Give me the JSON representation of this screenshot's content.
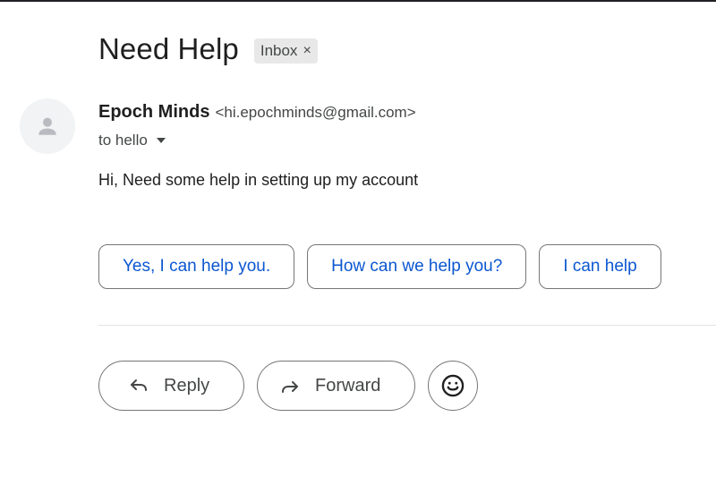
{
  "email": {
    "subject": "Need Help",
    "label": {
      "text": "Inbox",
      "remove_glyph": "×"
    },
    "sender": {
      "name": "Epoch Minds",
      "email": "<hi.epochminds@gmail.com>",
      "avatar_icon": "person-icon"
    },
    "recipient": "to hello",
    "body": "Hi, Need some help in setting up my account"
  },
  "smart_replies": [
    "Yes, I can help you.",
    "How can we help you?",
    "I can help"
  ],
  "actions": {
    "reply_label": "Reply",
    "reply_icon": "reply-arrow-icon",
    "forward_label": "Forward",
    "forward_icon": "forward-arrow-icon",
    "emoji_icon": "smiley-icon"
  },
  "colors": {
    "link_blue": "#0b57d0",
    "text_primary": "#1f1f1f",
    "text_secondary": "#444746",
    "chip_bg": "#e8e8e8",
    "border": "#747775"
  }
}
